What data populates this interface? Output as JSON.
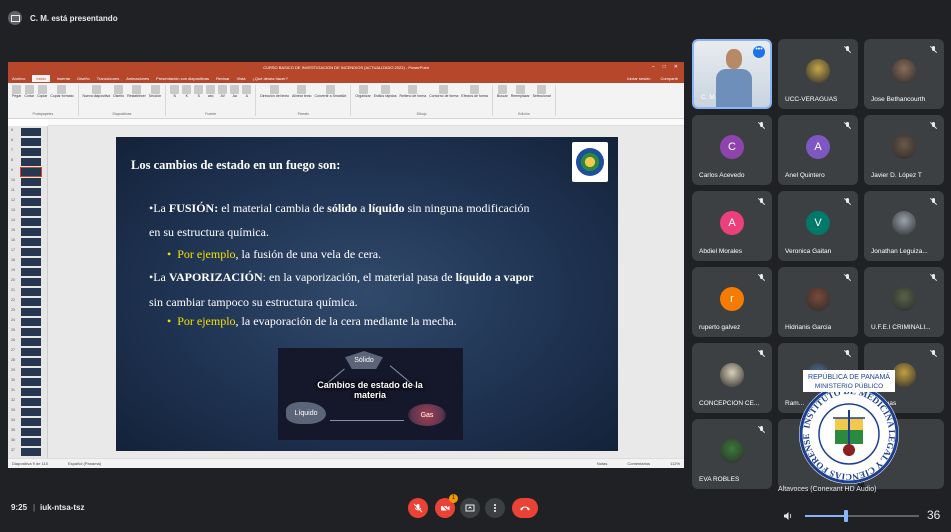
{
  "meeting": {
    "presenting_text": "C. M. está presentando",
    "time": "9:25",
    "separator": "|",
    "meeting_code": "iuk-ntsa-tsz"
  },
  "ppt": {
    "window_title": "CURSO BASICO DE INVESTIGACION DE INCENDIOS (ACTUALIZADO 2022) - PowerPoint",
    "menu": [
      "Archivo",
      "Inicio",
      "Insertar",
      "Diseño",
      "Transiciones",
      "Animaciones",
      "Presentación con diapositivas",
      "Revisar",
      "Vista",
      "¿Qué desea hacer?"
    ],
    "menu_active_index": 1,
    "menu_right": [
      "Iniciar sesión",
      "Compartir"
    ],
    "ribbon_groups": [
      {
        "name": "Portapapeles",
        "items": [
          "Pegar",
          "Cortar",
          "Copiar",
          "Copiar formato"
        ]
      },
      {
        "name": "Diapositivas",
        "items": [
          "Nueva diapositiva",
          "Diseño",
          "Restablecer",
          "Sección"
        ]
      },
      {
        "name": "Fuente",
        "items": [
          "N",
          "K",
          "S",
          "abc",
          "AV",
          "Aa",
          "A"
        ]
      },
      {
        "name": "Párrafo",
        "items": [
          "Dirección del texto",
          "Alinear texto",
          "Convertir a SmartArt"
        ]
      },
      {
        "name": "Dibujo",
        "items": [
          "Organizar",
          "Estilos rápidos",
          "Relleno de forma",
          "Contorno de forma",
          "Efectos de forma"
        ]
      },
      {
        "name": "Edición",
        "items": [
          "Buscar",
          "Reemplazar",
          "Seleccionar"
        ]
      }
    ],
    "thumb_numbers": [
      "5",
      "6",
      "7",
      "8",
      "9",
      "10",
      "11",
      "12",
      "13",
      "14",
      "15",
      "16",
      "17",
      "18",
      "19",
      "20",
      "21",
      "22",
      "23",
      "24",
      "25",
      "26",
      "27",
      "28",
      "29",
      "30",
      "31",
      "32",
      "33",
      "34",
      "35",
      "36",
      "37"
    ],
    "status_left": "Diapositiva 9 de 110",
    "status_lang": "Español (Panamá)",
    "status_notes": "Notas",
    "status_comments": "Comentarios",
    "status_zoom": "112%"
  },
  "slide": {
    "title": "Los cambios de estado en un fuego son:",
    "b1_pre": "•La ",
    "b1_bold1": "FUSIÓN:",
    "b1_mid": " el material cambia de ",
    "b1_bold2": "sólido",
    "b1_mid2": " a ",
    "b1_bold3": "líquido",
    "b1_post": " sin ninguna modificación",
    "b1_line2": "en su estructura química.",
    "s1_yellow": "Por ejemplo",
    "s1_rest": ", la fusión de una vela de cera.",
    "b2_pre": "•La ",
    "b2_bold1": "VAPORIZACIÓN",
    "b2_mid": ": en la vaporización, el material pasa de ",
    "b2_bold2": "líquido a vapor",
    "b2_line2": "sin cambiar tampoco su estructura química.",
    "s2_yellow": "Por ejemplo",
    "s2_rest": ", la evaporación de la cera mediante la mecha.",
    "diagram": {
      "center": "Cambios de estado de la materia",
      "solido": "Sólido",
      "liquido": "Líquido",
      "gas": "Gas"
    }
  },
  "participants": [
    {
      "name": "C. M.",
      "type": "video",
      "speaking": true
    },
    {
      "name": "UCC-VERAGUAS",
      "type": "photo",
      "color": "#c7a64a"
    },
    {
      "name": "Jose Bethancourth",
      "type": "photo",
      "color": "#8a6d5a"
    },
    {
      "name": "Carlos Acevedo",
      "type": "letter",
      "letter": "C",
      "color": "#8e44ad"
    },
    {
      "name": "Anel Quintero",
      "type": "letter",
      "letter": "A",
      "color": "#7e57c2"
    },
    {
      "name": "Javier D. López T",
      "type": "photo",
      "color": "#6b5848"
    },
    {
      "name": "Abdiel Morales",
      "type": "letter",
      "letter": "A",
      "color": "#ec407a"
    },
    {
      "name": "Veronica Gaitan",
      "type": "letter",
      "letter": "V",
      "color": "#00796b"
    },
    {
      "name": "Jonathan Leguiza...",
      "type": "photo",
      "color": "#9aa3ad"
    },
    {
      "name": "ruperto galvez",
      "type": "letter",
      "letter": "r",
      "color": "#f57c00"
    },
    {
      "name": "Hidrianis Garcia",
      "type": "photo",
      "color": "#7b4a3a"
    },
    {
      "name": "U.F.E.I CRIMINALI...",
      "type": "photo",
      "color": "#59624a"
    },
    {
      "name": "CONCEPCIÓN CE...",
      "type": "photo",
      "color": "#d8d0b8"
    },
    {
      "name": "Ram...",
      "type": "photo",
      "color": "#4a6a8a"
    },
    {
      "name": "...raguas",
      "type": "photo",
      "color": "#c2a040"
    },
    {
      "name": "EVA ROBLES",
      "type": "photo",
      "color": "#3c7a3a"
    },
    {
      "name": "",
      "type": "blank",
      "color": "#3c4043"
    },
    {
      "name": "",
      "type": "blank",
      "color": "#3c4043"
    }
  ],
  "seal": {
    "top_line1": "REPÚBLICA DE PANAMÁ",
    "top_line2": "MINISTERIO PÚBLICO",
    "ring_text": "INSTITUTO DE MEDICINA LEGAL Y CIENCIAS FORENSES"
  },
  "audio": {
    "label": "Altavoces (Conexant HD Audio)",
    "volume": 36,
    "volume_fraction": 0.36
  },
  "controls": {
    "chat_badge": "1"
  },
  "colors": {
    "ppt_accent": "#b7472a",
    "meet_bg": "#202124",
    "tile_bg": "#3c4043",
    "red": "#ea4335",
    "highlight": "#8ab4f8",
    "slide_yellow": "#f5e000"
  }
}
